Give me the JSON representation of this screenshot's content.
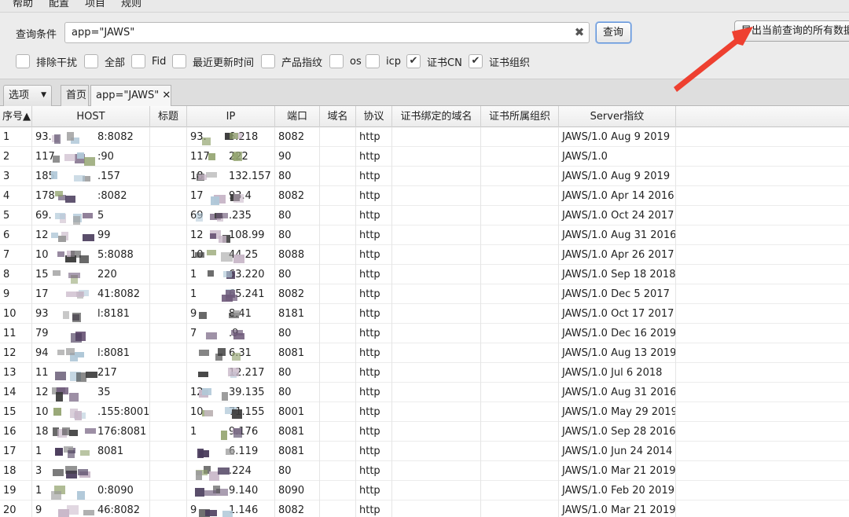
{
  "menubar": {
    "items": [
      "帮助",
      "配置",
      "项目",
      "规则"
    ]
  },
  "query": {
    "label": "查询条件",
    "value": "app=\"JAWS\"",
    "clear_glyph": "✖",
    "search_button": "查询",
    "export_button": "导出当前查询的所有数据"
  },
  "filters": [
    {
      "label": "排除干扰",
      "checked": false
    },
    {
      "label": "全部",
      "checked": false
    },
    {
      "label": "Fid",
      "checked": false
    },
    {
      "label": "最近更新时间",
      "checked": false
    },
    {
      "label": "产品指纹",
      "checked": false
    },
    {
      "label": "os",
      "checked": false
    },
    {
      "label": "icp",
      "checked": false
    },
    {
      "label": "证书CN",
      "checked": true
    },
    {
      "label": "证书组织",
      "checked": true
    }
  ],
  "tabs": {
    "options": "选项",
    "home": "首页",
    "query": "app=\"JAWS\"",
    "close_glyph": "✕"
  },
  "table": {
    "columns": [
      "序号▲",
      "HOST",
      "标题",
      "IP",
      "端口",
      "域名",
      "协议",
      "证书绑定的域名",
      "证书所属组织",
      "Server指纹"
    ],
    "rows": [
      [
        "1",
        "93.",
        "",
        "93.",
        "8082",
        "",
        "http",
        "",
        "",
        "JAWS/1.0 Aug 9 2019"
      ],
      [
        "2",
        "117",
        "",
        "117",
        "90",
        "",
        "http",
        "",
        "",
        "JAWS/1.0"
      ],
      [
        "3",
        "185",
        "",
        "18",
        "80",
        "",
        "http",
        "",
        "",
        "JAWS/1.0 Aug 9 2019"
      ],
      [
        "4",
        "178",
        "",
        "17",
        "8082",
        "",
        "http",
        "",
        "",
        "JAWS/1.0 Apr 14 2016"
      ],
      [
        "5",
        "69.",
        "",
        "69",
        "80",
        "",
        "http",
        "",
        "",
        "JAWS/1.0 Oct 24 2017"
      ],
      [
        "6",
        "12",
        "",
        "12",
        "80",
        "",
        "http",
        "",
        "",
        "JAWS/1.0 Aug 31 2016"
      ],
      [
        "7",
        "10",
        "",
        "10",
        "8088",
        "",
        "http",
        "",
        "",
        "JAWS/1.0 Apr 26 2017"
      ],
      [
        "8",
        "15",
        "",
        "1",
        "80",
        "",
        "http",
        "",
        "",
        "JAWS/1.0 Sep 18 2018"
      ],
      [
        "9",
        "17",
        "",
        "1",
        "8082",
        "",
        "http",
        "",
        "",
        "JAWS/1.0 Dec 5 2017"
      ],
      [
        "10",
        "93",
        "",
        "9",
        "8181",
        "",
        "http",
        "",
        "",
        "JAWS/1.0 Oct 17 2017"
      ],
      [
        "11",
        "79",
        "",
        "7",
        "80",
        "",
        "http",
        "",
        "",
        "JAWS/1.0 Dec 16 2019"
      ],
      [
        "12",
        "94",
        "",
        "",
        "8081",
        "",
        "http",
        "",
        "",
        "JAWS/1.0 Aug 13 2019"
      ],
      [
        "13",
        "11",
        "",
        "",
        "80",
        "",
        "http",
        "",
        "",
        "JAWS/1.0 Jul 6 2018"
      ],
      [
        "14",
        "12",
        "",
        "12",
        "80",
        "",
        "http",
        "",
        "",
        "JAWS/1.0 Aug 31 2016"
      ],
      [
        "15",
        "10",
        "",
        "10",
        "8001",
        "",
        "http",
        "",
        "",
        "JAWS/1.0 May 29 2019"
      ],
      [
        "16",
        "18",
        "",
        "1",
        "8081",
        "",
        "http",
        "",
        "",
        "JAWS/1.0 Sep 28 2016"
      ],
      [
        "17",
        "1",
        "",
        "",
        "8081",
        "",
        "http",
        "",
        "",
        "JAWS/1.0 Jun 24 2014"
      ],
      [
        "18",
        "3",
        "",
        "",
        "80",
        "",
        "http",
        "",
        "",
        "JAWS/1.0 Mar 21 2019"
      ],
      [
        "19",
        "1",
        "",
        "",
        "8090",
        "",
        "http",
        "",
        "",
        "JAWS/1.0 Feb 20 2019"
      ],
      [
        "20",
        "9",
        "",
        "9",
        "8082",
        "",
        "http",
        "",
        "",
        "JAWS/1.0 Mar 21 2019"
      ]
    ]
  },
  "colors": {
    "annotation_arrow": "#ee4030",
    "redaction": [
      "#3a3a3a",
      "#9a9a9a",
      "#6e5a7a",
      "#c9b8c9",
      "#8fa06a",
      "#b0c8d8",
      "#4a3c5c"
    ]
  }
}
